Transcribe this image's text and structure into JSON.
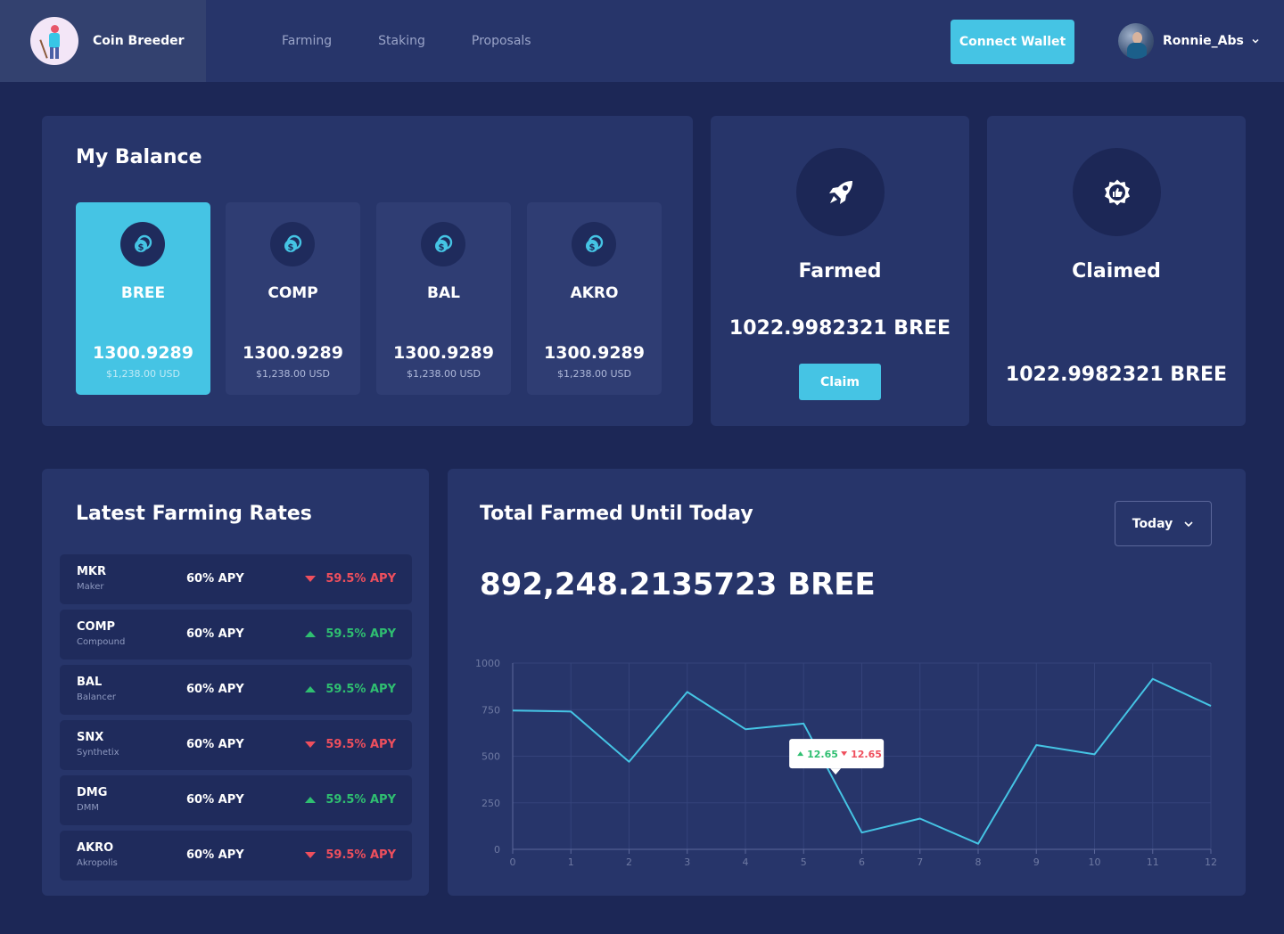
{
  "header": {
    "brand": "Coin Breeder",
    "nav": [
      "Farming",
      "Staking",
      "Proposals"
    ],
    "connect_label": "Connect Wallet",
    "user_name": "Ronnie_Abs"
  },
  "balance": {
    "title": "My Balance",
    "tiles": [
      {
        "name": "BREE",
        "amount": "1300.9289",
        "usd": "$1,238.00 USD",
        "active": true
      },
      {
        "name": "COMP",
        "amount": "1300.9289",
        "usd": "$1,238.00 USD",
        "active": false
      },
      {
        "name": "BAL",
        "amount": "1300.9289",
        "usd": "$1,238.00 USD",
        "active": false
      },
      {
        "name": "AKRO",
        "amount": "1300.9289",
        "usd": "$1,238.00 USD",
        "active": false
      }
    ]
  },
  "farmed": {
    "label": "Farmed",
    "value": "1022.9982321 BREE",
    "claim_label": "Claim",
    "icon": "rocket-icon"
  },
  "claimed": {
    "label": "Claimed",
    "value": "1022.9982321 BREE",
    "icon": "thumbs-up-badge-icon"
  },
  "rates": {
    "title": "Latest Farming Rates",
    "rows": [
      {
        "symbol": "MKR",
        "name": "Maker",
        "apy": "60% APY",
        "change": "59.5% APY",
        "direction": "down"
      },
      {
        "symbol": "COMP",
        "name": "Compound",
        "apy": "60% APY",
        "change": "59.5% APY",
        "direction": "up"
      },
      {
        "symbol": "BAL",
        "name": "Balancer",
        "apy": "60% APY",
        "change": "59.5% APY",
        "direction": "up"
      },
      {
        "symbol": "SNX",
        "name": "Synthetix",
        "apy": "60% APY",
        "change": "59.5% APY",
        "direction": "down"
      },
      {
        "symbol": "DMG",
        "name": "DMM",
        "apy": "60% APY",
        "change": "59.5% APY",
        "direction": "up"
      },
      {
        "symbol": "AKRO",
        "name": "Akropolis",
        "apy": "60% APY",
        "change": "59.5% APY",
        "direction": "down"
      }
    ]
  },
  "total_farmed": {
    "title": "Total Farmed Until Today",
    "range": "Today",
    "value": "892,248.2135723 BREE"
  },
  "colors": {
    "accent": "#45c4e4",
    "up": "#2fbf71",
    "down": "#ef4f5d",
    "bg": "#1c2756",
    "card": "#27356a"
  },
  "chart_data": {
    "type": "line",
    "x": [
      0,
      1,
      2,
      3,
      4,
      5,
      6,
      7,
      8,
      9,
      10,
      11,
      12
    ],
    "series": [
      {
        "values": [
          745,
          740,
          470,
          845,
          645,
          675,
          90,
          165,
          30,
          560,
          510,
          915,
          770
        ]
      }
    ],
    "xlim": [
      0,
      12
    ],
    "ylim": [
      0,
      1000
    ],
    "yticks": [
      0,
      250,
      500,
      750,
      1000
    ],
    "grid": true,
    "tooltip": {
      "up": "12.65",
      "down": "12.65",
      "x": 5.55
    }
  }
}
